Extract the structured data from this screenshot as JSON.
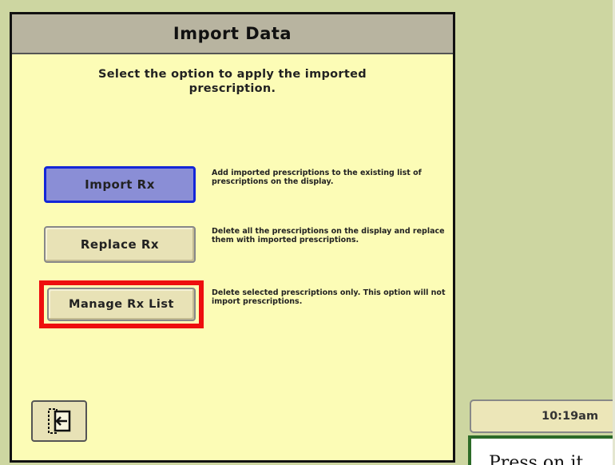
{
  "dialog": {
    "title": "Import Data",
    "instruction": "Select the option to apply the imported prescription."
  },
  "options": [
    {
      "label": "Import Rx",
      "description": "Add imported prescriptions to the existing list of prescriptions on the display.",
      "state": "selected"
    },
    {
      "label": "Replace Rx",
      "description": "Delete all the prescriptions on the display and replace them with imported prescriptions."
    },
    {
      "label": "Manage Rx List",
      "description": "Delete selected prescriptions only.  This option will not import prescriptions.",
      "highlight": "red-outline"
    }
  ],
  "back_button": {
    "icon": "exit-back-icon"
  },
  "status": {
    "time": "10:19am"
  },
  "tip": {
    "text": "Press on it"
  },
  "colors": {
    "background": "#cdd6a1",
    "dialog_body": "#fcfcb6",
    "dialog_header": "#b8b4a0",
    "selected_button": "#8a8ed6",
    "selected_border": "#1326d8",
    "highlight": "#ee0e0e",
    "tip_border": "#2c6b28"
  }
}
